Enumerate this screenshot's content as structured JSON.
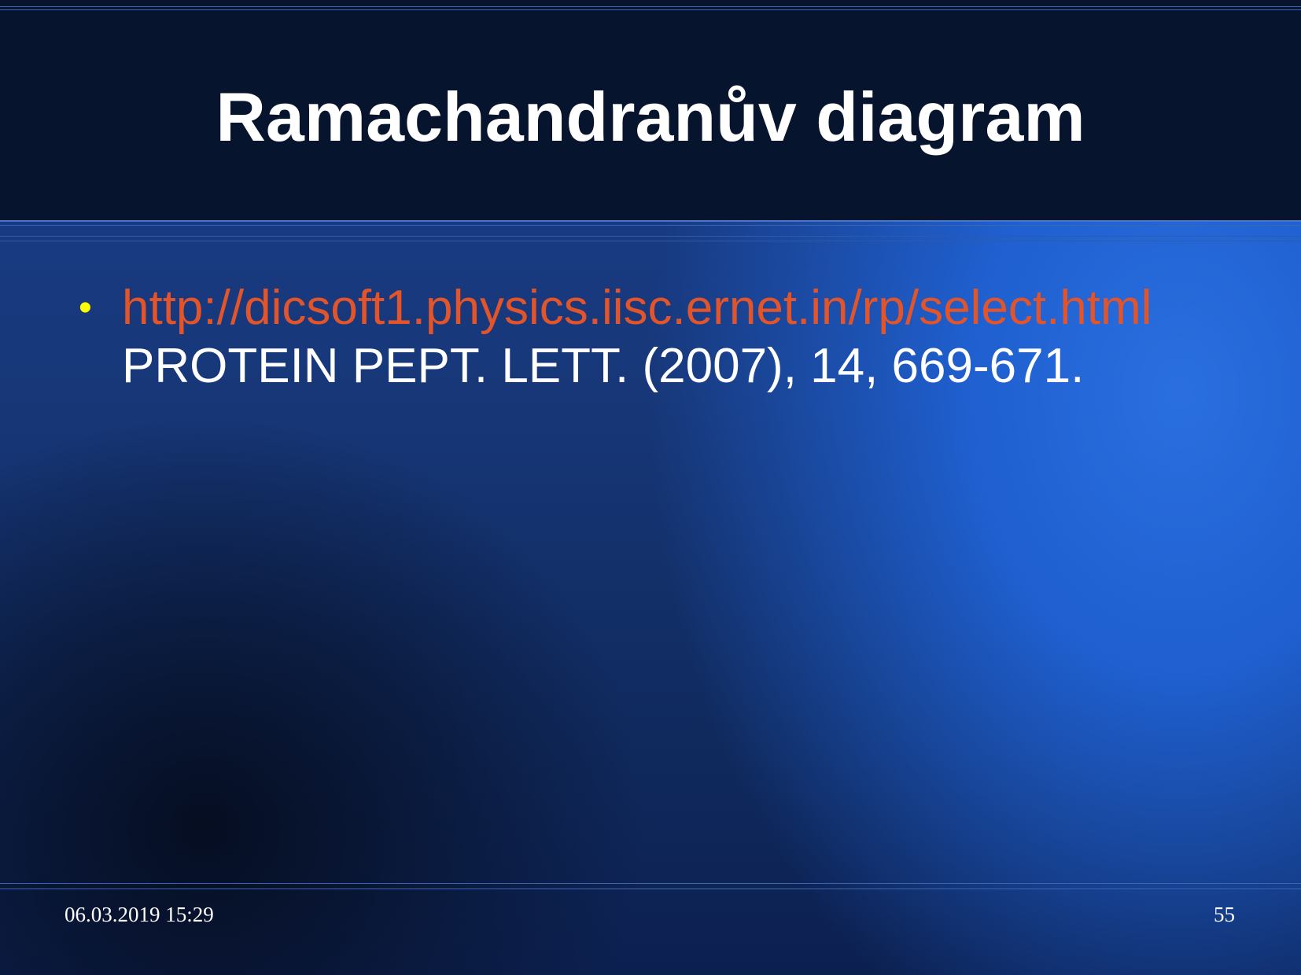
{
  "slide": {
    "title": "Ramachandranův diagram",
    "bullets": [
      {
        "link_text": "http://dicsoft1.physics.iisc.ernet.in/rp/select.html",
        "reference": "PROTEIN PEPT. LETT. (2007), 14, 669-671."
      }
    ],
    "bullet_symbol": "•"
  },
  "footer": {
    "date": "06.03.2019 15:29",
    "page_number": "55"
  },
  "colors": {
    "title_band": "#06142d",
    "link": "#e2542a",
    "bullet": "#ffff00",
    "text": "#ffffff",
    "rule": "#4a76c8"
  }
}
